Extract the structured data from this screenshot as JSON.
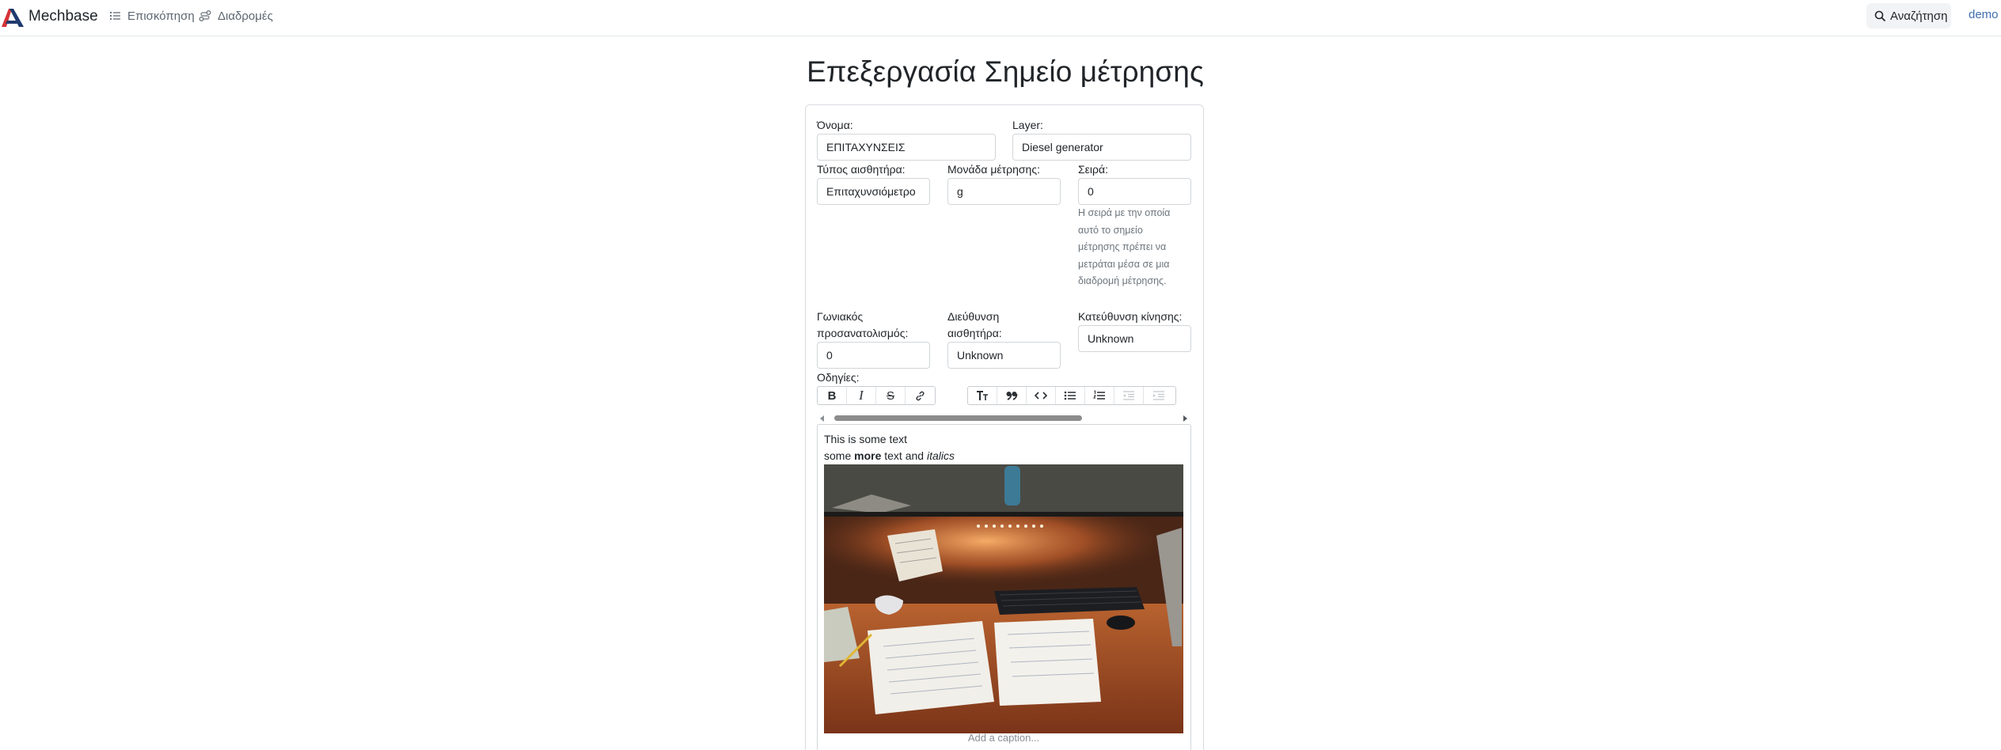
{
  "nav": {
    "brand": "Mechbase",
    "overview": "Επισκόπηση",
    "routes": "Διαδρομές",
    "search": "Αναζήτηση",
    "user": "demo"
  },
  "page": {
    "title": "Επεξεργασία Σημείο μέτρησης"
  },
  "form": {
    "name": {
      "label": "Όνομα:",
      "value": "ΕΠΙΤΑΧΥΝΣΕΙΣ"
    },
    "layer": {
      "label": "Layer:",
      "value": "Diesel generator"
    },
    "sensor_type": {
      "label": "Τύπος αισθητήρα:",
      "value": "Επιταχυνσιόμετρο"
    },
    "unit": {
      "label": "Μονάδα μέτρησης:",
      "value": "g"
    },
    "order": {
      "label": "Σειρά:",
      "value": "0",
      "help": "Η σειρά με την οποία αυτό το σημείο μέτρησης πρέπει να μετράται μέσα σε μια διαδρομή μέτρησης."
    },
    "angle": {
      "label": "Γωνιακός προσανατολισμός:",
      "value": "0"
    },
    "sensor_direction": {
      "label": "Διεύθυνση αισθητήρα:",
      "value": "Unknown"
    },
    "motion_direction": {
      "label": "Κατεύθυνση κίνησης:",
      "value": "Unknown"
    },
    "instructions": {
      "label": "Οδηγίες:"
    }
  },
  "editor": {
    "toolbar_icons": [
      "bold-icon",
      "italic-icon",
      "strikethrough-icon",
      "link-icon",
      "heading-icon",
      "quote-icon",
      "code-icon",
      "bullet-list-icon",
      "numbered-list-icon",
      "outdent-icon",
      "indent-icon"
    ],
    "line1": "This is some text",
    "line2_a": "some ",
    "line2_bold": "more",
    "line2_b": " text and ",
    "line2_italic": "italics",
    "image": "desk-photo",
    "caption_placeholder": "Add a caption..."
  },
  "colors": {
    "brand_red": "#d63337",
    "brand_navy": "#1f3a6e",
    "link": "#3f6fb0",
    "muted": "#6c757d"
  }
}
